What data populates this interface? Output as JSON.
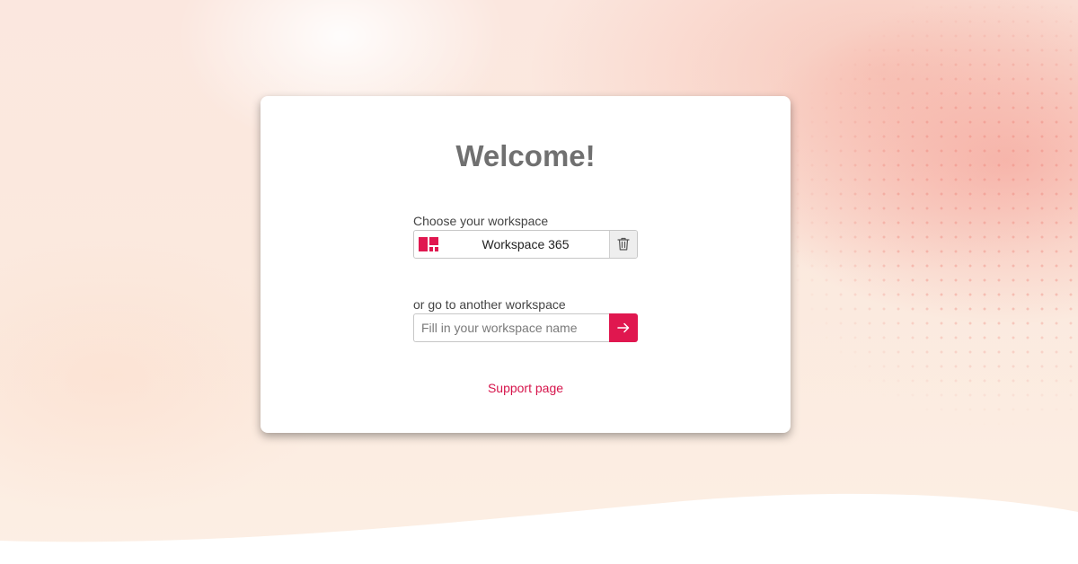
{
  "card": {
    "title": "Welcome!",
    "choose_label": "Choose your workspace",
    "workspace": {
      "name": "Workspace 365",
      "logo_icon": "workspace-logo-icon",
      "remove_icon": "trash-icon"
    },
    "other_label": "or go to another workspace",
    "input": {
      "placeholder": "Fill in your workspace name",
      "value": ""
    },
    "go_icon": "arrow-right-icon",
    "support_link": "Support page"
  },
  "colors": {
    "accent": "#e0174f",
    "title": "#707070",
    "text": "#444444"
  }
}
